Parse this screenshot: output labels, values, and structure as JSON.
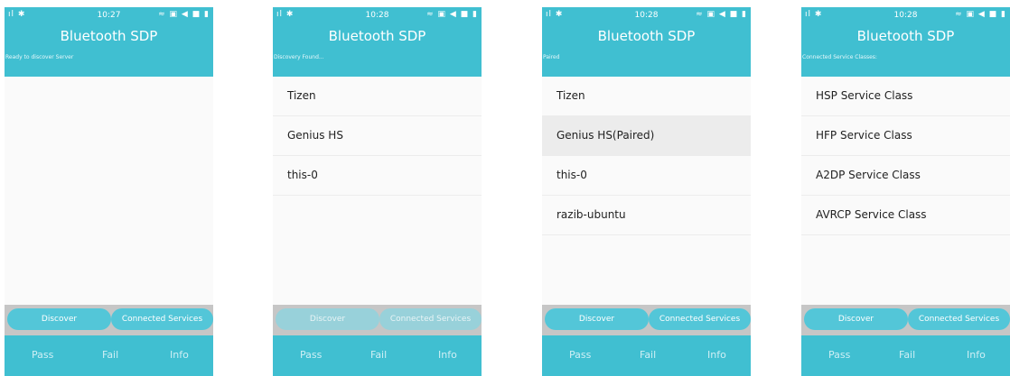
{
  "app_title": "Bluetooth SDP",
  "status_left": "ıl ✱",
  "status_right": "≈ ▣ ◀ ■ ▮",
  "footer": {
    "pass": "Pass",
    "fail": "Fail",
    "info": "Info"
  },
  "buttons": {
    "discover": "Discover",
    "connected_services": "Connected Services"
  },
  "screens": [
    {
      "time": "10:27",
      "subtitle": "Ready to discover Server",
      "items": [],
      "buttons_disabled": false
    },
    {
      "time": "10:28",
      "subtitle": "Discovery Found...",
      "items": [
        "Tizen",
        "Genius HS",
        "this-0"
      ],
      "buttons_disabled": true
    },
    {
      "time": "10:28",
      "subtitle": "Paired",
      "items": [
        "Tizen",
        "Genius HS(Paired)",
        "this-0",
        "razib-ubuntu"
      ],
      "selected_item": 1,
      "buttons_disabled": false
    },
    {
      "time": "10:28",
      "subtitle": "Connected Service Classes:",
      "items": [
        "HSP Service Class",
        "HFP Service Class",
        "A2DP Service Class",
        "AVRCP Service Class"
      ],
      "buttons_disabled": false
    }
  ],
  "colors": {
    "accent": "#40bfd1",
    "button": "#53c6d8",
    "button_disabled": "#98d1da",
    "selected_row": "#ececec"
  }
}
